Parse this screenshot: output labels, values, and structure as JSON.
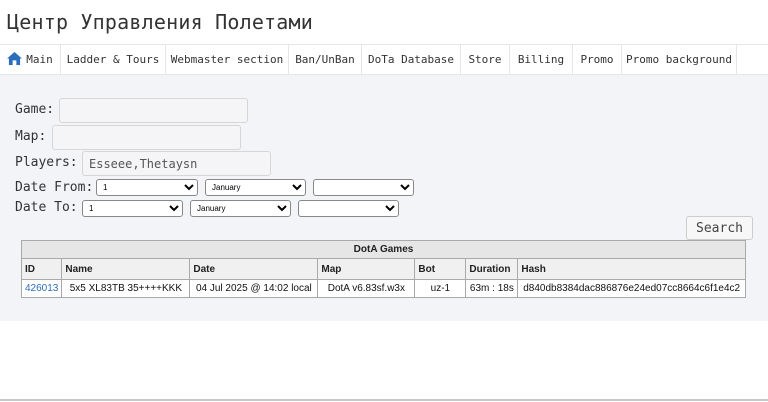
{
  "page_title": "Центр Управления Полетами",
  "nav": {
    "items": [
      {
        "label": "Main",
        "icon": "home-icon"
      },
      {
        "label": "Ladder & Tours"
      },
      {
        "label": "Webmaster section"
      },
      {
        "label": "Ban/UnBan"
      },
      {
        "label": "DoTa Database"
      },
      {
        "label": "Store"
      },
      {
        "label": "Billing"
      },
      {
        "label": "Promo"
      },
      {
        "label": "Promo background"
      }
    ]
  },
  "form": {
    "game_label": "Game:",
    "game_value": "",
    "map_label": "Map:",
    "map_value": "",
    "players_label": "Players:",
    "players_value": "Esseee,Thetaysn",
    "date_from_label": "Date From:",
    "date_from": {
      "day": "1",
      "month": "January",
      "year": ""
    },
    "date_to_label": "Date To:",
    "date_to": {
      "day": "1",
      "month": "January",
      "year": ""
    },
    "search_label": "Search"
  },
  "table": {
    "caption": "DotA Games",
    "columns": [
      "ID",
      "Name",
      "Date",
      "Map",
      "Bot",
      "Duration",
      "Hash"
    ],
    "rows": [
      {
        "id": "426013",
        "name": "5x5 XL83TB 35++++KKK",
        "date": "04 Jul 2025 @ 14:02 local",
        "map": "DotA v6.83sf.w3x",
        "bot": "uz-1",
        "duration": "63m : 18s",
        "hash": "d840db8384dac886876e24ed07cc8664c6f1e4c2"
      }
    ]
  },
  "colors": {
    "accent": "#2a6ebb",
    "panel_bg": "#f2f4f8"
  }
}
